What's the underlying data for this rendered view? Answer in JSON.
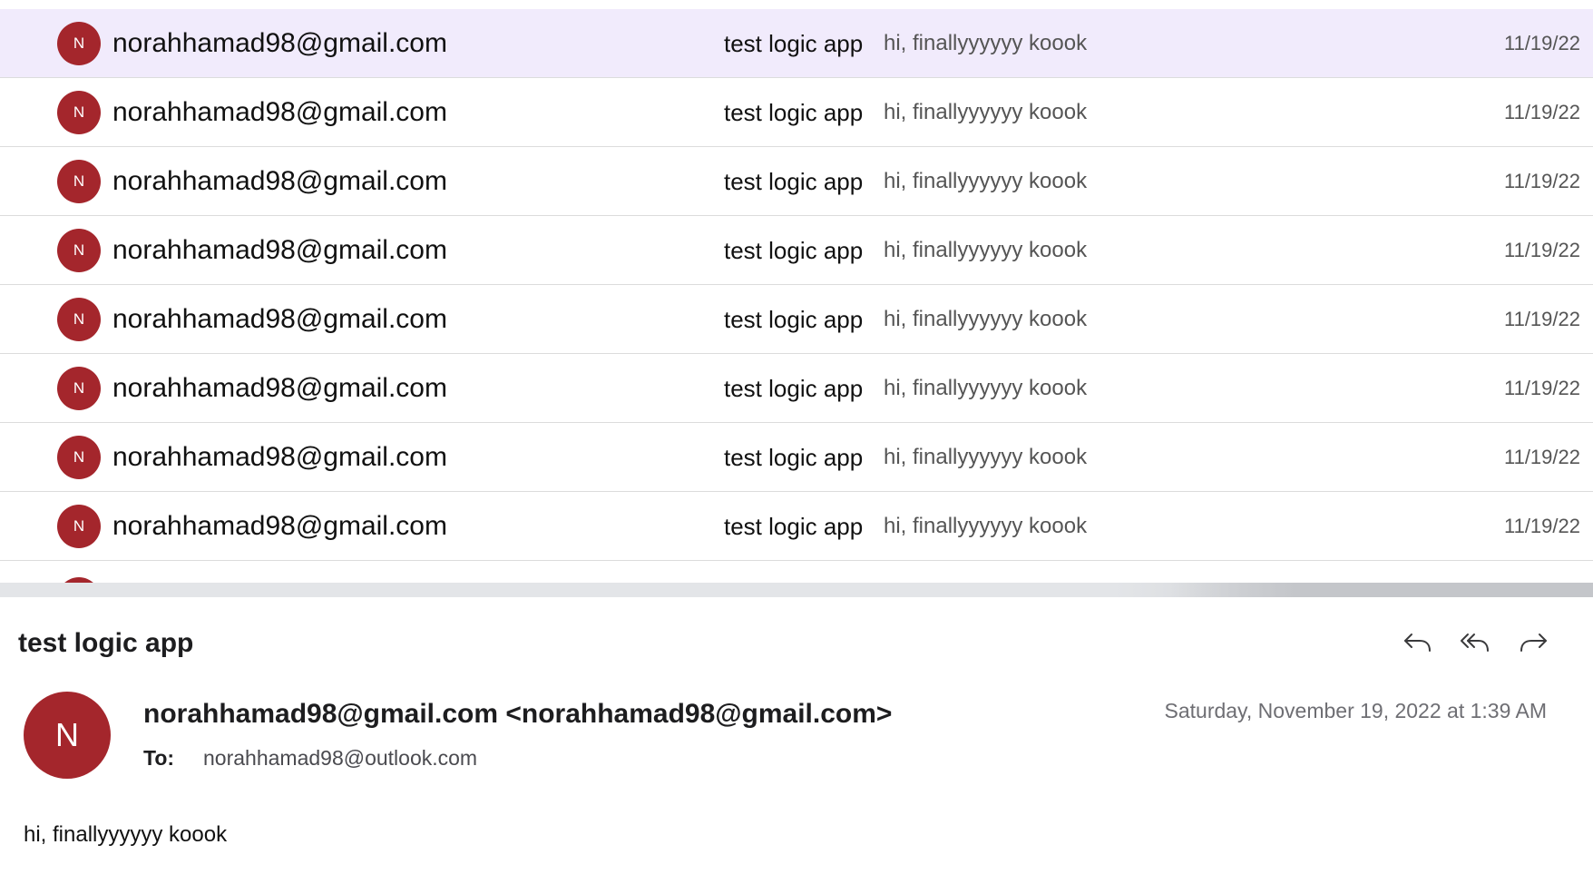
{
  "message_list": {
    "rows": [
      {
        "avatar_initial": "N",
        "sender": "norahhamad98@gmail.com",
        "subject": "test logic app",
        "preview": "hi, finallyyyyyy koook",
        "date": "11/19/22",
        "selected": true
      },
      {
        "avatar_initial": "N",
        "sender": "norahhamad98@gmail.com",
        "subject": "test logic app",
        "preview": "hi, finallyyyyyy koook",
        "date": "11/19/22",
        "selected": false
      },
      {
        "avatar_initial": "N",
        "sender": "norahhamad98@gmail.com",
        "subject": "test logic app",
        "preview": "hi, finallyyyyyy koook",
        "date": "11/19/22",
        "selected": false
      },
      {
        "avatar_initial": "N",
        "sender": "norahhamad98@gmail.com",
        "subject": "test logic app",
        "preview": "hi, finallyyyyyy koook",
        "date": "11/19/22",
        "selected": false
      },
      {
        "avatar_initial": "N",
        "sender": "norahhamad98@gmail.com",
        "subject": "test logic app",
        "preview": "hi, finallyyyyyy koook",
        "date": "11/19/22",
        "selected": false
      },
      {
        "avatar_initial": "N",
        "sender": "norahhamad98@gmail.com",
        "subject": "test logic app",
        "preview": "hi, finallyyyyyy koook",
        "date": "11/19/22",
        "selected": false
      },
      {
        "avatar_initial": "N",
        "sender": "norahhamad98@gmail.com",
        "subject": "test logic app",
        "preview": "hi, finallyyyyyy koook",
        "date": "11/19/22",
        "selected": false
      },
      {
        "avatar_initial": "N",
        "sender": "norahhamad98@gmail.com",
        "subject": "test logic app",
        "preview": "hi, finallyyyyyy koook",
        "date": "11/19/22",
        "selected": false
      }
    ]
  },
  "reading_pane": {
    "subject": "test logic app",
    "avatar_initial": "N",
    "from": "norahhamad98@gmail.com <norahhamad98@gmail.com>",
    "sent_date": "Saturday, November 19, 2022 at 1:39 AM",
    "to_label": "To:",
    "to_address": "norahhamad98@outlook.com",
    "body": "hi, finallyyyyyy koook",
    "actions": [
      {
        "name": "reply",
        "icon": "reply-icon"
      },
      {
        "name": "reply-all",
        "icon": "reply-all-icon"
      },
      {
        "name": "forward",
        "icon": "forward-icon"
      }
    ]
  },
  "colors": {
    "avatar_bg": "#a4262c",
    "selected_row_bg": "#f1ebfc",
    "divider": "#dcdcdc",
    "secondary_text": "#6e6e73"
  }
}
